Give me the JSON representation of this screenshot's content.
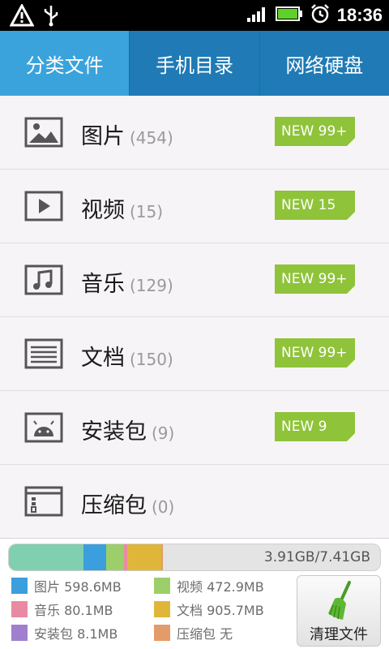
{
  "status_bar": {
    "time": "18:36",
    "left_icons": [
      "warning-icon",
      "usb-icon"
    ],
    "right_icons": [
      "signal-icon",
      "battery-icon",
      "alarm-icon"
    ]
  },
  "tabs": [
    {
      "label": "分类文件",
      "active": true
    },
    {
      "label": "手机目录",
      "active": false
    },
    {
      "label": "网络硬盘",
      "active": false
    }
  ],
  "categories": [
    {
      "name": "图片",
      "count": "(454)",
      "badge": "NEW 99+",
      "icon": "image-icon"
    },
    {
      "name": "视频",
      "count": "(15)",
      "badge": "NEW 15",
      "icon": "video-icon"
    },
    {
      "name": "音乐",
      "count": "(129)",
      "badge": "NEW 99+",
      "icon": "music-icon"
    },
    {
      "name": "文档",
      "count": "(150)",
      "badge": "NEW 99+",
      "icon": "document-icon"
    },
    {
      "name": "安装包",
      "count": "(9)",
      "badge": "NEW  9",
      "icon": "android-icon"
    },
    {
      "name": "压缩包",
      "count": "(0)",
      "badge": "",
      "icon": "archive-icon"
    }
  ],
  "storage": {
    "usage_text": "3.91GB/7.41GB",
    "segments": [
      {
        "name": "图片",
        "color": "#3a9fdc",
        "fraction": 0.0
      },
      {
        "name": "other",
        "color": "#7fcfb0",
        "fraction": 0.2
      },
      {
        "name": "图片",
        "color": "#3a9fdc",
        "fraction": 0.06
      },
      {
        "name": "视频",
        "color": "#9ccf6a",
        "fraction": 0.05
      },
      {
        "name": "音乐",
        "color": "#e98aa3",
        "fraction": 0.006
      },
      {
        "name": "文档",
        "color": "#e0b63a",
        "fraction": 0.09
      },
      {
        "name": "压缩包",
        "color": "#e39b6a",
        "fraction": 0.003
      }
    ],
    "legend": [
      {
        "label": "图片 598.6MB",
        "color": "#3a9fdc"
      },
      {
        "label": "视频 472.9MB",
        "color": "#9ccf6a"
      },
      {
        "label": "音乐 80.1MB",
        "color": "#e98aa3"
      },
      {
        "label": "文档 905.7MB",
        "color": "#e0b63a"
      },
      {
        "label": "安装包 8.1MB",
        "color": "#a07fcf"
      },
      {
        "label": "压缩包 无",
        "color": "#e39b6a"
      }
    ],
    "clean_button": "清理文件"
  }
}
